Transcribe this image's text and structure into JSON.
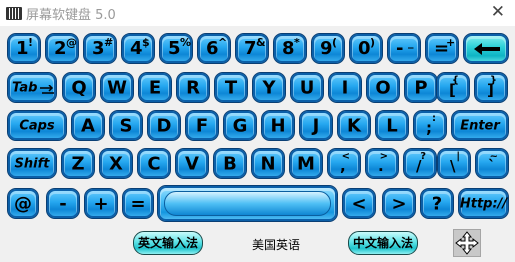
{
  "window": {
    "title": "屏幕软键盘 5.0",
    "close": "✕"
  },
  "keys": {
    "row1": [
      {
        "main": "1",
        "sup": "!"
      },
      {
        "main": "2",
        "sup": "@"
      },
      {
        "main": "3",
        "sup": "#"
      },
      {
        "main": "4",
        "sup": "$"
      },
      {
        "main": "5",
        "sup": "%"
      },
      {
        "main": "6",
        "sup": "^"
      },
      {
        "main": "7",
        "sup": "&"
      },
      {
        "main": "8",
        "sup": "*"
      },
      {
        "main": "9",
        "sup": "("
      },
      {
        "main": "0",
        "sup": ")"
      },
      {
        "main": "-",
        "sup": "_"
      },
      {
        "main": "=",
        "sup": "+"
      }
    ],
    "backspace": "backspace",
    "row2_tab": "Tab",
    "row2": [
      "Q",
      "W",
      "E",
      "R",
      "T",
      "Y",
      "U",
      "I",
      "O",
      "P"
    ],
    "row2_sym": [
      {
        "main": "[",
        "sup": "{"
      },
      {
        "main": "]",
        "sup": "}"
      }
    ],
    "row3_caps": "Caps",
    "row3": [
      "A",
      "S",
      "D",
      "F",
      "G",
      "H",
      "J",
      "K",
      "L"
    ],
    "row3_sym": [
      {
        "main": ";",
        "sup": ":"
      }
    ],
    "row3_enter": "Enter",
    "row4_shift": "Shift",
    "row4": [
      "Z",
      "X",
      "C",
      "V",
      "B",
      "N",
      "M"
    ],
    "row4_sym": [
      {
        "main": ",",
        "sup": "<"
      },
      {
        "main": ".",
        "sup": ">"
      },
      {
        "main": "/",
        "sup": "?"
      },
      {
        "main": "\\",
        "sup": "|"
      },
      {
        "main": "`",
        "sup": "~"
      }
    ],
    "row5_left": [
      "@",
      "-",
      "+",
      "="
    ],
    "row5_right": [
      "<",
      ">",
      "?"
    ],
    "http": "Http://"
  },
  "status": {
    "english_ime": "英文输入法",
    "layout": "美国英语",
    "chinese_ime": "中文输入法"
  },
  "colors": {
    "key_blue": "#1e9fe8",
    "key_border": "#0a3f74",
    "backspace_cyan": "#22c8d2"
  }
}
